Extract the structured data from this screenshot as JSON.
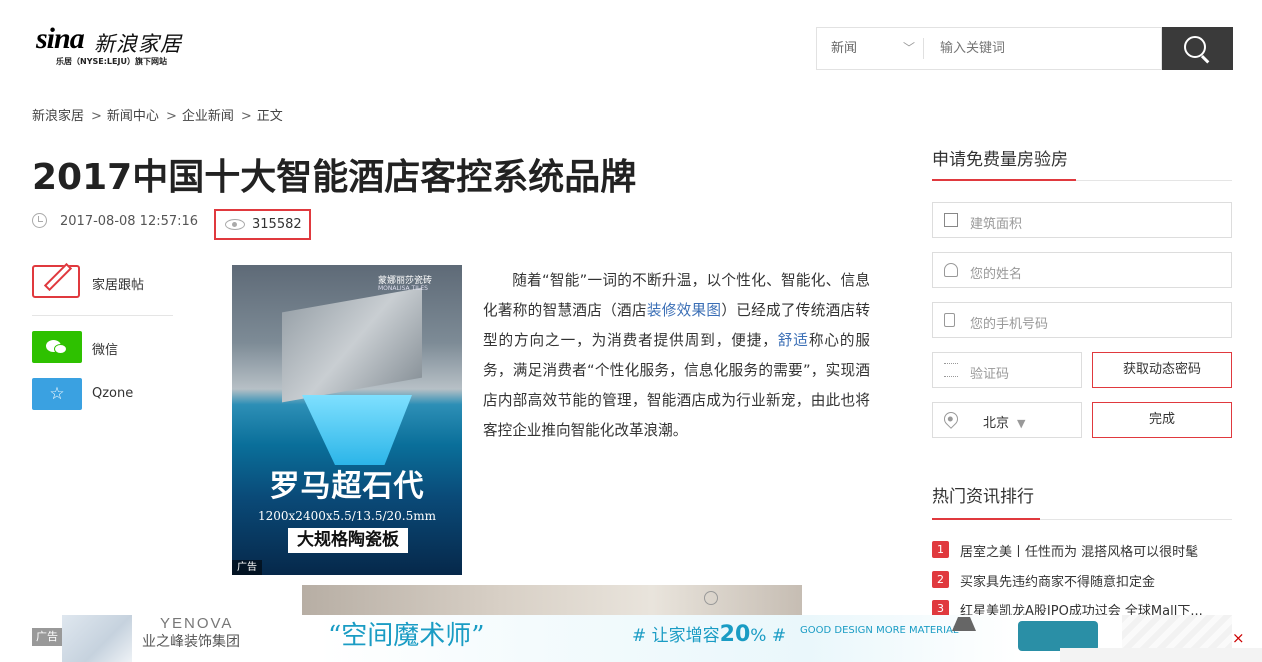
{
  "header": {
    "logo_main": "sina",
    "logo_cn": "新浪家居",
    "logo_sub": "乐居（NYSE:LEJU）旗下网站",
    "search_category": "新闻",
    "search_placeholder": "输入关键词"
  },
  "breadcrumb": [
    "新浪家居",
    "新闻中心",
    "企业新闻",
    "正文"
  ],
  "breadcrumb_sep": ">",
  "article": {
    "title": "2017中国十大智能酒店客控系统品牌",
    "datetime": "2017-08-08 12:57:16",
    "views": "315582",
    "p1_a": "随着“智能”一词的不断升温，以个性化、智能化、信息化著称的智慧酒店（酒店",
    "p1_link1": "装修效果图",
    "p1_b": "）已经成了传统酒店转型的方向之一，为消费者提供周到，便捷，",
    "p1_link2": "舒适",
    "p1_c": "称心的服务，满足消费者“个性化服务，信息化服务的需要”，实现酒店内部高效节能的管理，智能酒店成为行业新宠，由此也将客控企业推向智能化改革浪潮。"
  },
  "share": {
    "post_label": "家居跟帖",
    "wechat_label": "微信",
    "qzone_label": "Qzone"
  },
  "ad1": {
    "brand": "蒙娜丽莎瓷砖",
    "brand_en": "MONALISA TILES",
    "headline": "罗马超石代",
    "spec": "1200x2400x5.5/13.5/20.5mm",
    "tag": "大规格陶瓷板",
    "ad_label": "广告"
  },
  "sidebar": {
    "form_title": "申请免费量房验房",
    "area_placeholder": "建筑面积",
    "name_placeholder": "您的姓名",
    "phone_placeholder": "您的手机号码",
    "code_placeholder": "验证码",
    "get_code_button": "获取动态密码",
    "city": "北京",
    "submit_button": "完成",
    "ranking_title": "热门资讯排行",
    "ranking": [
      {
        "num": "1",
        "text": "居室之美丨任性而为 混搭风格可以很时髦"
      },
      {
        "num": "2",
        "text": "买家具先违约商家不得随意扣定金"
      },
      {
        "num": "3",
        "text": "红星美凯龙A股IPO成功过会 全球Mall下..."
      }
    ]
  },
  "banner": {
    "ad_label": "广告",
    "brand_en": "YENOVA",
    "brand_cn": "业之峰装饰集团",
    "slogan": "“空间魔术师”",
    "hash_a": "# 让家增容",
    "hash_num": "20",
    "hash_b": "% #",
    "good": "GOOD DESIGN MORE MATERIAL",
    "close": "×"
  },
  "colors": {
    "accent": "#e0393e",
    "wechat": "#2ec100",
    "qzone": "#3aa1e1",
    "link": "#3b6fb6"
  }
}
